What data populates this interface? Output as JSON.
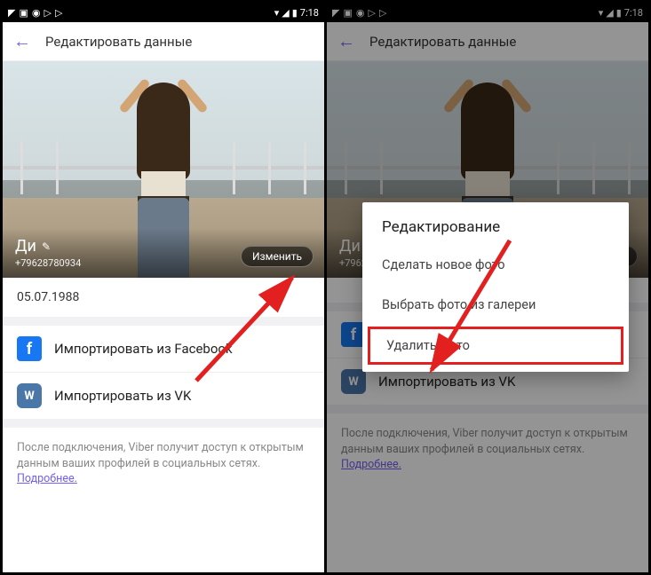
{
  "statusbar": {
    "time": "7:18"
  },
  "appbar": {
    "title": "Редактировать данные"
  },
  "profile": {
    "name": "Ди",
    "phone": "+79628780934",
    "change_btn": "Изменить",
    "change_btn_short": "енить"
  },
  "birthday": "05.07.1988",
  "imports": {
    "facebook": "Импортировать из Facebook",
    "vk": "Импортировать из VK"
  },
  "footer": {
    "text": "После подключения, Viber получит доступ к открытым данным ваших профилей в социальных сетях.",
    "link": "Подробнее."
  },
  "dialog": {
    "title": "Редактирование",
    "new_photo": "Сделать новое фото",
    "gallery": "Выбрать фото из галереи",
    "delete": "Удалить фото"
  }
}
